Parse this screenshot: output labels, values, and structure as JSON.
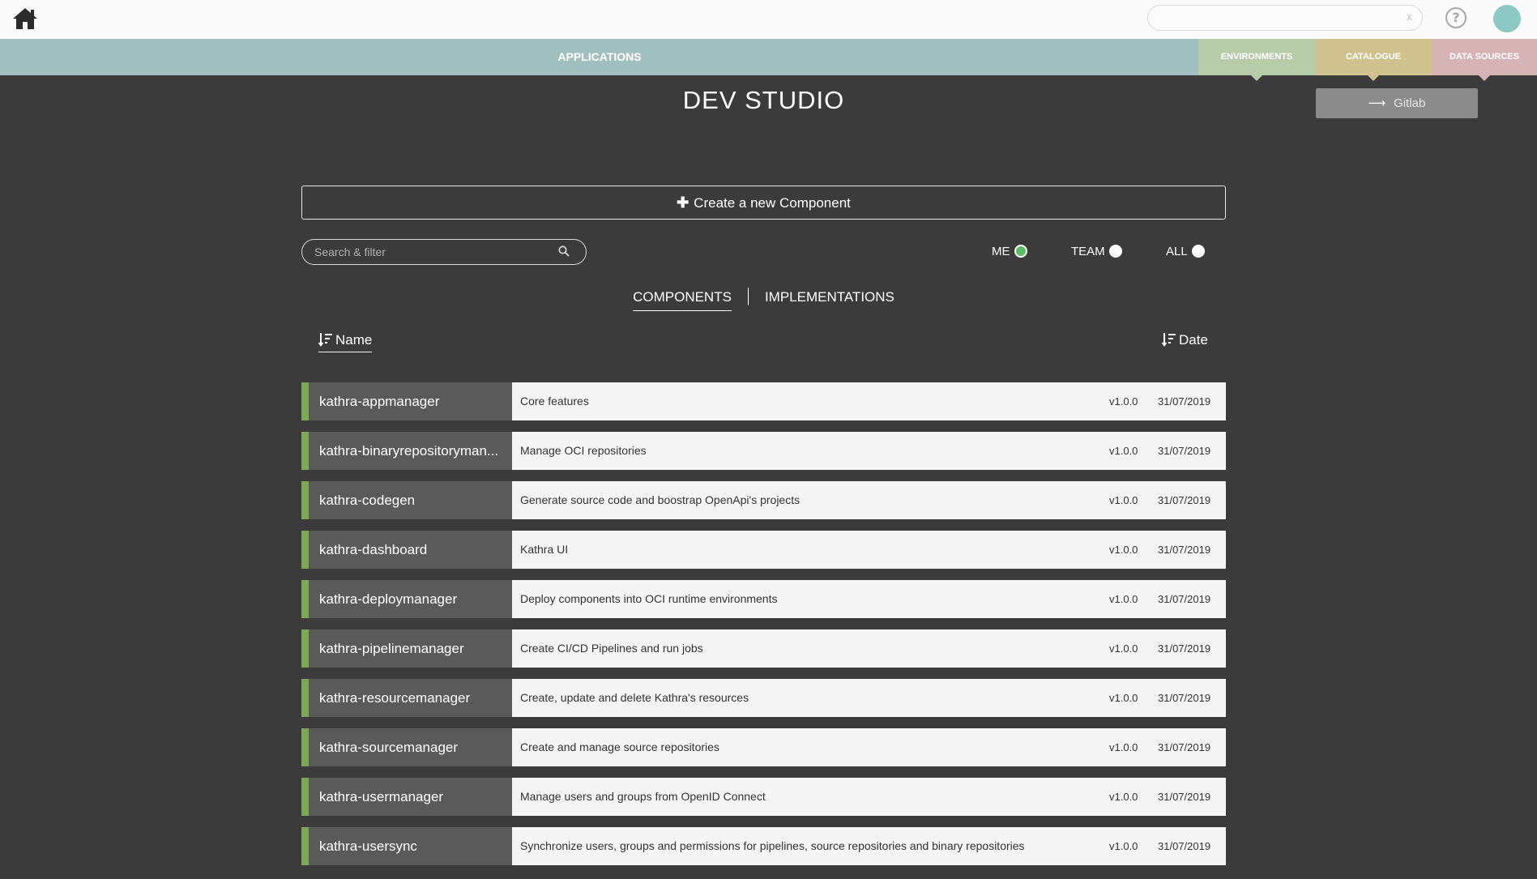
{
  "header": {
    "search_clear": "x",
    "help": "?"
  },
  "nav": {
    "applications": "APPLICATIONS",
    "environments": "ENVIRONMENTS",
    "catalogue": "CATALOGUE",
    "data_sources": "DATA SOURCES",
    "colors": {
      "applications": "#a0bfbe",
      "environments": "#b7cba9",
      "catalogue": "#cfc28f",
      "data_sources": "#d6b3b5"
    }
  },
  "gitlab_button": {
    "label": "Gitlab",
    "icon": "arrow-right-icon"
  },
  "page": {
    "title": "DEV STUDIO",
    "create_label": "Create a new Component",
    "search_placeholder": "Search & filter"
  },
  "scope_filter": {
    "me": "ME",
    "team": "TEAM",
    "all": "ALL",
    "selected": "ME"
  },
  "tabs": {
    "components": "COMPONENTS",
    "implementations": "IMPLEMENTATIONS",
    "active": "COMPONENTS"
  },
  "sort": {
    "name": "Name",
    "date": "Date"
  },
  "components": [
    {
      "name": "kathra-appmanager",
      "description": "Core features",
      "version": "v1.0.0",
      "date": "31/07/2019"
    },
    {
      "name": "kathra-binaryrepositoryman...",
      "description": "Manage OCI repositories",
      "version": "v1.0.0",
      "date": "31/07/2019"
    },
    {
      "name": "kathra-codegen",
      "description": "Generate source code and boostrap OpenApi's projects",
      "version": "v1.0.0",
      "date": "31/07/2019"
    },
    {
      "name": "kathra-dashboard",
      "description": "Kathra UI",
      "version": "v1.0.0",
      "date": "31/07/2019"
    },
    {
      "name": "kathra-deploymanager",
      "description": "Deploy components into OCI runtime environments",
      "version": "v1.0.0",
      "date": "31/07/2019"
    },
    {
      "name": "kathra-pipelinemanager",
      "description": "Create CI/CD Pipelines and run jobs",
      "version": "v1.0.0",
      "date": "31/07/2019"
    },
    {
      "name": "kathra-resourcemanager",
      "description": "Create, update and delete Kathra's resources",
      "version": "v1.0.0",
      "date": "31/07/2019"
    },
    {
      "name": "kathra-sourcemanager",
      "description": "Create and manage source repositories",
      "version": "v1.0.0",
      "date": "31/07/2019"
    },
    {
      "name": "kathra-usermanager",
      "description": "Manage users and groups from OpenID Connect",
      "version": "v1.0.0",
      "date": "31/07/2019"
    },
    {
      "name": "kathra-usersync",
      "description": "Synchronize users, groups and permissions for pipelines, source repositories and binary repositories",
      "version": "v1.0.0",
      "date": "31/07/2019"
    }
  ],
  "colors": {
    "background": "#3b3b3b",
    "status_accent": "#7ea758",
    "selected_radio": "#5dbb63",
    "avatar": "#8bc9c2"
  }
}
